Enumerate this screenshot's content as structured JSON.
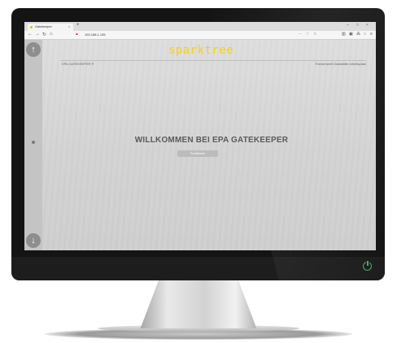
{
  "browser": {
    "tab_title": "Gatekeeper",
    "tab_close": "×",
    "new_tab": "+",
    "window_controls": [
      "–",
      "□",
      "×"
    ],
    "url": "192.168.1.135",
    "toolbar_icons": [
      "back-icon",
      "forward-icon",
      "reload-icon",
      "home-icon"
    ]
  },
  "page": {
    "logo_text": "sparktree",
    "header_left": "EPA GATEKEEPER ®",
    "header_right": "Themenwelt Gaststätte Arbeitsplatz",
    "welcome_title": "WILLKOMMEN BEI EPA GATEKEEPER",
    "continue_button": "Fortfahren",
    "rail_up_icon": "↑",
    "rail_down_icon": "↓"
  },
  "colors": {
    "logo": "#f2d21a",
    "power_led": "#4fa86a"
  }
}
